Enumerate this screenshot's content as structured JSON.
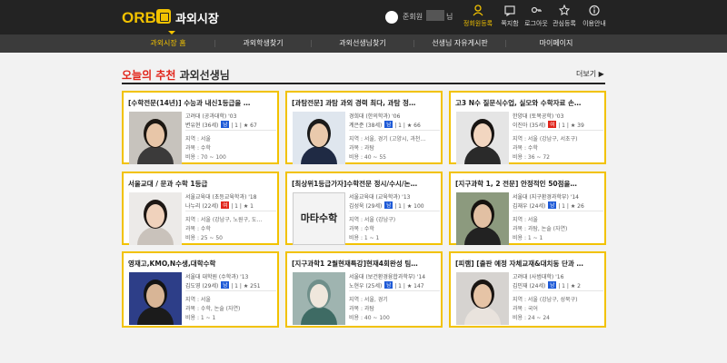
{
  "header": {
    "logo": "ORBI",
    "site_name": "과외시장",
    "member_grade": "준회원",
    "member_suffix": "님",
    "icons": [
      {
        "label": "정회원등록",
        "icon": "person-icon",
        "active": true
      },
      {
        "label": "쪽지함",
        "icon": "message-icon",
        "active": false
      },
      {
        "label": "로그아웃",
        "icon": "key-icon",
        "active": false
      },
      {
        "label": "관심등록",
        "icon": "star-icon",
        "active": false
      },
      {
        "label": "이용안내",
        "icon": "info-icon",
        "active": false
      }
    ]
  },
  "nav": {
    "items": [
      {
        "label": "과외시장 홈",
        "active": true
      },
      {
        "label": "과외학생찾기",
        "active": false
      },
      {
        "label": "과외선생님찾기",
        "active": false
      },
      {
        "label": "선생님 자유게시판",
        "active": false
      },
      {
        "label": "마이페이지",
        "active": false
      }
    ]
  },
  "section": {
    "title_highlight": "오늘의 추천",
    "title_rest": "과외선생님",
    "more": "더보기 ▶"
  },
  "colors": {
    "accent": "#f2c200",
    "highlight": "#e1251b",
    "male": "#1e5ad7",
    "female": "#e1251b"
  },
  "cards": [
    {
      "title": "[수학전문(14년)] 수능과 내신1등급을 …",
      "school": "고려대 (공과대학) '03",
      "name": "변유현 (36세)",
      "gender": "남",
      "count": "1",
      "rating": "★ 67",
      "region": "지역 : 서울",
      "subject": "과목 : 수학",
      "fee": "비용 : 70 ~ 100"
    },
    {
      "title": "[과탐전문] 과탐 과외 경력 최다, 과탐 정…",
      "school": "경희대 (한의학과) '06",
      "name": "계은준 (38세)",
      "gender": "남",
      "count": "1",
      "rating": "★ 66",
      "region": "지역 : 서울, 경기 (고양시, 과천…",
      "subject": "과목 : 과탐",
      "fee": "비용 : 40 ~ 55"
    },
    {
      "title": "고3 N수 질문식수업, 실모와 수학자료 손…",
      "school": "한양대 (토목공학) '03",
      "name": "이진아 (35세)",
      "gender": "여",
      "count": "1",
      "rating": "★ 39",
      "region": "지역 : 서울 (강남구, 서초구)",
      "subject": "과목 : 수학",
      "fee": "비용 : 36 ~ 72"
    },
    {
      "title": "서울교대 / 문과 수학 1등급",
      "school": "서울교육대 (초등교육학과) '18",
      "name": "나누리 (22세)",
      "gender": "여",
      "count": "1",
      "rating": "★ 1",
      "region": "지역 : 서울 (강남구, 노원구, 도…",
      "subject": "과목 : 수학",
      "fee": "비용 : 25 ~ 50"
    },
    {
      "title": "[최상위1등급가자]수학전문 정시/수시/논…",
      "school": "서울교육대 (교육학과) '13",
      "name": "김성욱 (29세)",
      "gender": "남",
      "count": "1",
      "rating": "★ 100",
      "region": "지역 : 서울 (강남구)",
      "subject": "과목 : 수학",
      "fee": "비용 : 1 ~ 1",
      "photo_text": "마타수학"
    },
    {
      "title": "[지구과학 1, 2 전문] 안정적인 50점을…",
      "school": "서울대 (지구환경과학부) '14",
      "name": "김재우 (24세)",
      "gender": "남",
      "count": "1",
      "rating": "★ 26",
      "region": "지역 : 서울",
      "subject": "과목 : 과탐, 논술 (자연)",
      "fee": "비용 : 1 ~ 1"
    },
    {
      "title": "영재고,KMO,N수생,대학수학",
      "school": "서울대 대학원 (수학과) '13",
      "name": "김도영 (29세)",
      "gender": "남",
      "count": "1",
      "rating": "★ 251",
      "region": "지역 : 서울",
      "subject": "과목 : 수학, 논술 (자연)",
      "fee": "비용 : 1 ~ 1"
    },
    {
      "title": "[지구과학1 2월현재특강]현재4회완성 팀…",
      "school": "서울대 (보건환경융합과학부) '14",
      "name": "노현우 (25세)",
      "gender": "남",
      "count": "1",
      "rating": "★ 147",
      "region": "지역 : 서울, 경기",
      "subject": "과목 : 과탐",
      "fee": "비용 : 40 ~ 100"
    },
    {
      "title": "[피램] [출판 예정 자체교재&대치동 단과 …",
      "school": "고려대 (사범대학) '16",
      "name": "김민재 (24세)",
      "gender": "남",
      "count": "1",
      "rating": "★ 2",
      "region": "지역 : 서울 (강남구, 성북구)",
      "subject": "과목 : 국어",
      "fee": "비용 : 24 ~ 24"
    }
  ]
}
